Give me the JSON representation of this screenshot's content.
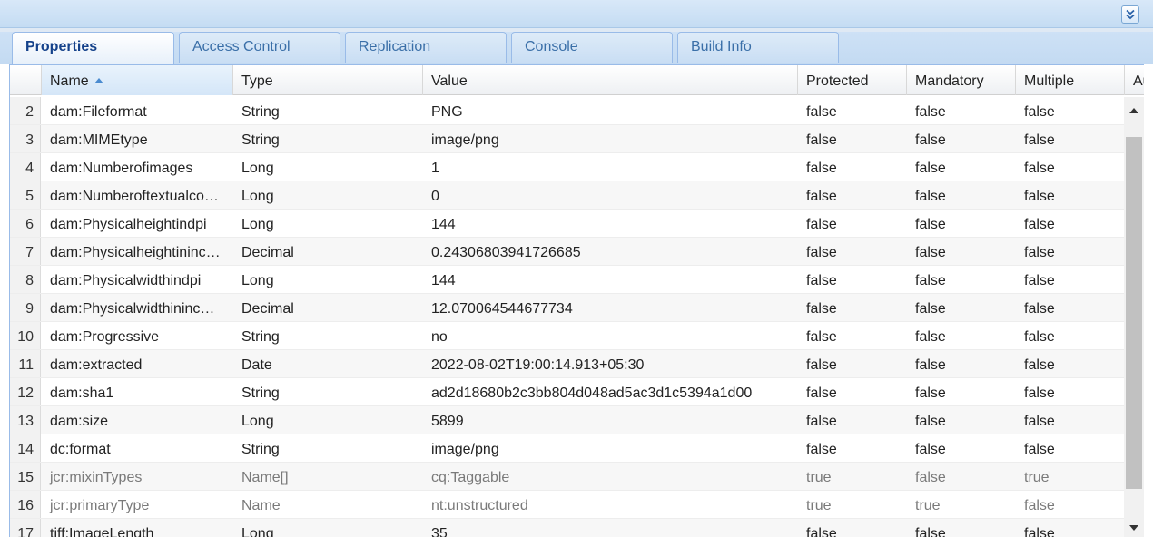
{
  "tabs": [
    {
      "label": "Properties",
      "active": true
    },
    {
      "label": "Access Control",
      "active": false
    },
    {
      "label": "Replication",
      "active": false
    },
    {
      "label": "Console",
      "active": false
    },
    {
      "label": "Build Info",
      "active": false
    }
  ],
  "icons": {
    "collapse": "double-chevron-down-icon",
    "sort": "sort-ascending-icon",
    "scroll_up": "arrow-up-icon",
    "scroll_down": "arrow-down-icon"
  },
  "colors": {
    "accent": "#15428b",
    "tab_border": "#99bbe8",
    "sort_arrow": "#4a8bd0"
  },
  "grid": {
    "columns": [
      "Name",
      "Type",
      "Value",
      "Protected",
      "Mandatory",
      "Multiple",
      "Au"
    ],
    "sorted_column": "Name",
    "sort_direction": "ascending",
    "rows": [
      {
        "num": "2",
        "name": "dam:Fileformat",
        "type": "String",
        "value": "PNG",
        "protected": "false",
        "mandatory": "false",
        "multiple": "false",
        "inherited": false
      },
      {
        "num": "3",
        "name": "dam:MIMEtype",
        "type": "String",
        "value": "image/png",
        "protected": "false",
        "mandatory": "false",
        "multiple": "false",
        "inherited": false
      },
      {
        "num": "4",
        "name": "dam:Numberofimages",
        "type": "Long",
        "value": "1",
        "protected": "false",
        "mandatory": "false",
        "multiple": "false",
        "inherited": false
      },
      {
        "num": "5",
        "name": "dam:Numberoftextualco…",
        "type": "Long",
        "value": "0",
        "protected": "false",
        "mandatory": "false",
        "multiple": "false",
        "inherited": false
      },
      {
        "num": "6",
        "name": "dam:Physicalheightindpi",
        "type": "Long",
        "value": "144",
        "protected": "false",
        "mandatory": "false",
        "multiple": "false",
        "inherited": false
      },
      {
        "num": "7",
        "name": "dam:Physicalheightininc…",
        "type": "Decimal",
        "value": "0.24306803941726685",
        "protected": "false",
        "mandatory": "false",
        "multiple": "false",
        "inherited": false
      },
      {
        "num": "8",
        "name": "dam:Physicalwidthindpi",
        "type": "Long",
        "value": "144",
        "protected": "false",
        "mandatory": "false",
        "multiple": "false",
        "inherited": false
      },
      {
        "num": "9",
        "name": "dam:Physicalwidthininc…",
        "type": "Decimal",
        "value": "12.070064544677734",
        "protected": "false",
        "mandatory": "false",
        "multiple": "false",
        "inherited": false
      },
      {
        "num": "10",
        "name": "dam:Progressive",
        "type": "String",
        "value": "no",
        "protected": "false",
        "mandatory": "false",
        "multiple": "false",
        "inherited": false
      },
      {
        "num": "11",
        "name": "dam:extracted",
        "type": "Date",
        "value": "2022-08-02T19:00:14.913+05:30",
        "protected": "false",
        "mandatory": "false",
        "multiple": "false",
        "inherited": false
      },
      {
        "num": "12",
        "name": "dam:sha1",
        "type": "String",
        "value": "ad2d18680b2c3bb804d048ad5ac3d1c5394a1d00",
        "protected": "false",
        "mandatory": "false",
        "multiple": "false",
        "inherited": false
      },
      {
        "num": "13",
        "name": "dam:size",
        "type": "Long",
        "value": "5899",
        "protected": "false",
        "mandatory": "false",
        "multiple": "false",
        "inherited": false
      },
      {
        "num": "14",
        "name": "dc:format",
        "type": "String",
        "value": "image/png",
        "protected": "false",
        "mandatory": "false",
        "multiple": "false",
        "inherited": false
      },
      {
        "num": "15",
        "name": "jcr:mixinTypes",
        "type": "Name[]",
        "value": "cq:Taggable",
        "protected": "true",
        "mandatory": "false",
        "multiple": "true",
        "inherited": true
      },
      {
        "num": "16",
        "name": "jcr:primaryType",
        "type": "Name",
        "value": "nt:unstructured",
        "protected": "true",
        "mandatory": "true",
        "multiple": "false",
        "inherited": true
      },
      {
        "num": "17",
        "name": "tiff:ImageLength",
        "type": "Long",
        "value": "35",
        "protected": "false",
        "mandatory": "false",
        "multiple": "false",
        "inherited": false
      }
    ]
  }
}
